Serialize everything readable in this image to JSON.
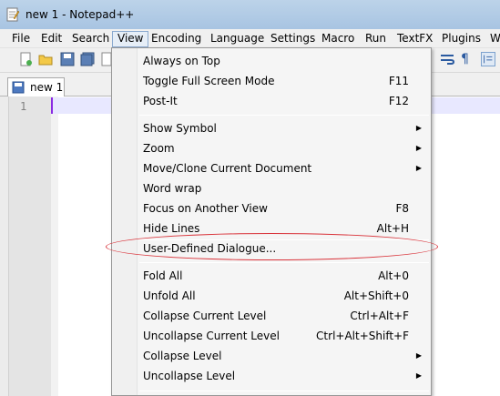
{
  "window": {
    "title": "new  1 - Notepad++"
  },
  "menubar": {
    "items": [
      "File",
      "Edit",
      "Search",
      "View",
      "Encoding",
      "Language",
      "Settings",
      "Macro",
      "Run",
      "TextFX",
      "Plugins",
      "W"
    ],
    "active": "View"
  },
  "tabs": [
    {
      "label": "new  1"
    }
  ],
  "editor": {
    "line_number": "1"
  },
  "view_menu": {
    "items": [
      {
        "label": "Always on Top",
        "shortcut": ""
      },
      {
        "label": "Toggle Full Screen Mode",
        "shortcut": "F11"
      },
      {
        "label": "Post-It",
        "shortcut": "F12"
      },
      {
        "label": "Show Symbol",
        "shortcut": "",
        "submenu": true
      },
      {
        "label": "Zoom",
        "shortcut": "",
        "submenu": true
      },
      {
        "label": "Move/Clone Current Document",
        "shortcut": "",
        "submenu": true
      },
      {
        "label": "Word wrap",
        "shortcut": ""
      },
      {
        "label": "Focus on Another View",
        "shortcut": "F8"
      },
      {
        "label": "Hide Lines",
        "shortcut": "Alt+H"
      },
      {
        "label": "User-Defined Dialogue...",
        "shortcut": "",
        "annotated": true
      },
      {
        "label": "Fold All",
        "shortcut": "Alt+0"
      },
      {
        "label": "Unfold All",
        "shortcut": "Alt+Shift+0"
      },
      {
        "label": "Collapse Current Level",
        "shortcut": "Ctrl+Alt+F"
      },
      {
        "label": "Uncollapse Current Level",
        "shortcut": "Ctrl+Alt+Shift+F"
      },
      {
        "label": "Collapse Level",
        "shortcut": "",
        "submenu": true
      },
      {
        "label": "Uncollapse Level",
        "shortcut": "",
        "submenu": true
      }
    ]
  },
  "colors": {
    "annotation_oval": "#d9333a",
    "current_line_marker": "#8a2be2"
  }
}
